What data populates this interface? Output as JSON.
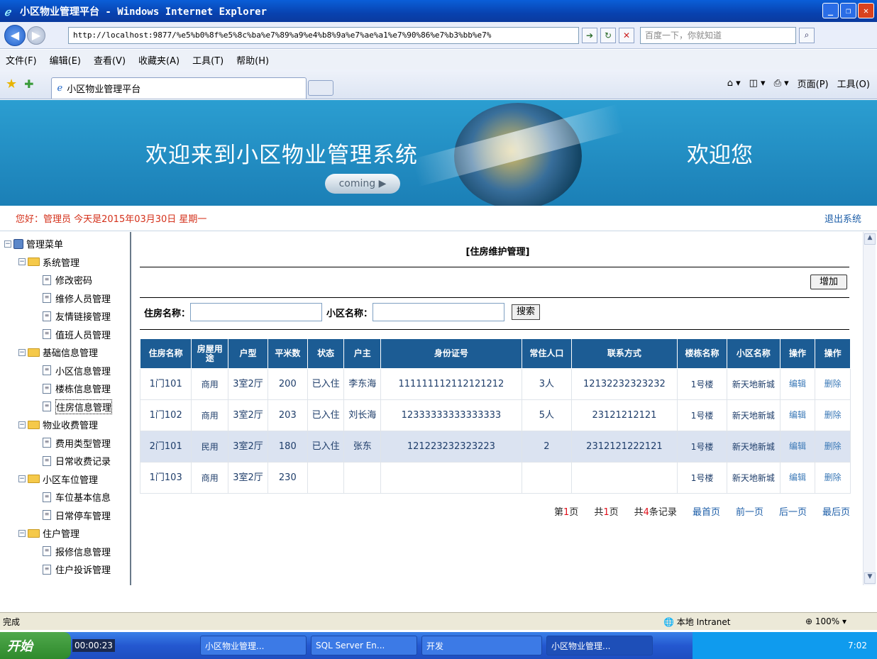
{
  "window": {
    "title": "小区物业管理平台 - Windows Internet Explorer"
  },
  "browser": {
    "url": "http://localhost:9877/%e5%b0%8f%e5%8c%ba%e7%89%a9%e4%b8%9a%e7%ae%a1%e7%90%86%e7%b3%bb%e7%",
    "search_placeholder": "百度一下，你就知道",
    "menu": [
      "文件(F)",
      "编辑(E)",
      "查看(V)",
      "收藏夹(A)",
      "工具(T)",
      "帮助(H)"
    ],
    "tab_title": "小区物业管理平台",
    "tools": {
      "page": "页面(P)",
      "tools": "工具(O)"
    }
  },
  "banner": {
    "welcome": "欢迎来到小区物业管理系统",
    "coming": "coming",
    "greeting": "欢迎您"
  },
  "userbar": {
    "info": "您好：管理员  今天是2015年03月30日  星期一",
    "logout": "退出系统"
  },
  "sidebar": {
    "root": "管理菜单",
    "groups": [
      {
        "label": "系统管理",
        "items": [
          "修改密码",
          "维修人员管理",
          "友情链接管理",
          "值班人员管理"
        ]
      },
      {
        "label": "基础信息管理",
        "items": [
          "小区信息管理",
          "楼栋信息管理",
          "住房信息管理"
        ]
      },
      {
        "label": "物业收费管理",
        "items": [
          "费用类型管理",
          "日常收费记录"
        ]
      },
      {
        "label": "小区车位管理",
        "items": [
          "车位基本信息",
          "日常停车管理"
        ]
      },
      {
        "label": "住户管理",
        "items": [
          "报修信息管理",
          "住户投诉管理"
        ]
      }
    ]
  },
  "page": {
    "title": "[住房维护管理]",
    "add_button": "增加",
    "search": {
      "house_label": "住房名称：",
      "community_label": "小区名称：",
      "button": "搜索"
    }
  },
  "table": {
    "headers": [
      "住房名称",
      "房屋用途",
      "户型",
      "平米数",
      "状态",
      "户主",
      "身份证号",
      "常住人口",
      "联系方式",
      "楼栋名称",
      "小区名称",
      "操作",
      "操作"
    ],
    "rows": [
      [
        "1门101",
        "商用",
        "3室2厅",
        "200",
        "已入住",
        "李东海",
        "111111112112121212",
        "3人",
        "12132232323232",
        "1号楼",
        "新天地新城",
        "编辑",
        "删除"
      ],
      [
        "1门102",
        "商用",
        "3室2厅",
        "203",
        "已入住",
        "刘长海",
        "12333333333333333",
        "5人",
        "23121212121",
        "1号楼",
        "新天地新城",
        "编辑",
        "删除"
      ],
      [
        "2门101",
        "民用",
        "3室2厅",
        "180",
        "已入住",
        "张东",
        "121223232323223",
        "2",
        "2312121222121",
        "1号楼",
        "新天地新城",
        "编辑",
        "删除"
      ],
      [
        "1门103",
        "商用",
        "3室2厅",
        "230",
        "",
        "",
        "",
        "",
        "",
        "1号楼",
        "新天地新城",
        "编辑",
        "删除"
      ]
    ]
  },
  "pager": {
    "page_prefix": "第",
    "current": "1",
    "page_suffix": "页",
    "total_prefix": "共",
    "total_pages": "1",
    "total_suffix": "页",
    "records_prefix": "共",
    "records": "4",
    "records_suffix": "条记录",
    "first": "最首页",
    "prev": "前一页",
    "next": "后一页",
    "last": "最后页"
  },
  "status": {
    "text": "完成",
    "zone": "本地 Intranet",
    "zoom": "100%"
  },
  "taskbar": {
    "start": "开始",
    "clock_box": "00:00:23",
    "tasks": [
      "小区物业管理...",
      "SQL Server En...",
      "开发",
      "小区物业管理..."
    ],
    "time": "7:02"
  }
}
